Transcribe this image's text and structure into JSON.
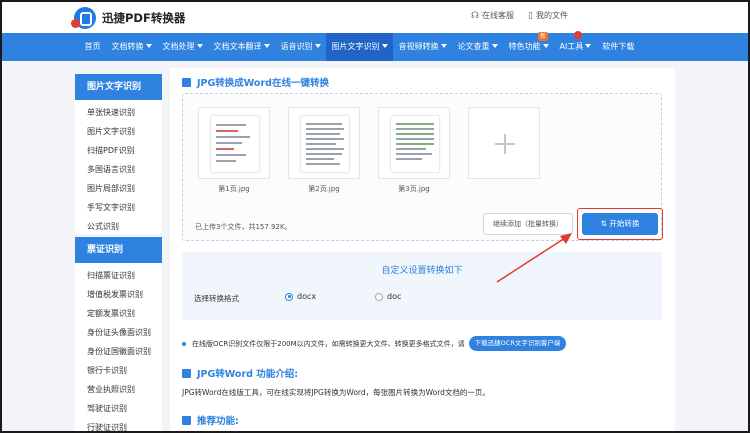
{
  "header": {
    "logo_text": "迅捷PDF转换器",
    "service_link": "在线客服",
    "files_link": "我的文件"
  },
  "nav": {
    "items": [
      {
        "label": "首页"
      },
      {
        "label": "文档转换"
      },
      {
        "label": "文档处理"
      },
      {
        "label": "文档文本翻译"
      },
      {
        "label": "语音识别"
      },
      {
        "label": "图片文字识别"
      },
      {
        "label": "音视频转换"
      },
      {
        "label": "论文查重"
      },
      {
        "label": "特色功能"
      },
      {
        "label": "AI工具"
      },
      {
        "label": "软件下载"
      }
    ],
    "new_badge": "新"
  },
  "sidebar": {
    "group1_title": "图片文字识别",
    "group1_items": [
      "单张快速识别",
      "图片文字识别",
      "扫描PDF识别",
      "多国语言识别",
      "图片局部识别",
      "手写文字识别",
      "公式识别"
    ],
    "group2_title": "票证识别",
    "group2_items": [
      "扫描票证识别",
      "增值税发票识别",
      "定额发票识别",
      "身份证头像面识别",
      "身份证国徽面识别",
      "银行卡识别",
      "营业执照识别",
      "驾驶证识别",
      "行驶证识别"
    ]
  },
  "main": {
    "title": "JPG转换成Word在线一键转换",
    "thumbnails": [
      {
        "label": "第1页.jpg"
      },
      {
        "label": "第2页.jpg"
      },
      {
        "label": "第3页.jpg"
      }
    ],
    "upload_info": "已上传3个文件，共157.92K。",
    "continue_button": "继续添加（批量转换）",
    "start_button": "开始转换",
    "settings_title": "自定义设置转换如下",
    "format_label": "选择转换格式",
    "format_options": [
      "docx",
      "doc"
    ],
    "selected_format": "docx",
    "notice": "在线版OCR识别文件仅限于200M以内文件，如需转换更大文件、转换更多格式文件，请",
    "client_button": "下载迅捷OCR文字识别客户端",
    "intro_title": "JPG转Word 功能介绍:",
    "intro_text": "JPG转Word在线版工具，可在线实现将JPG转换为Word，每张图片转换为Word文档的一页。",
    "recommend_title": "推荐功能:"
  },
  "colors": {
    "brand_blue": "#2f82e0",
    "nav_active": "#1f64c6",
    "highlight_red": "#e23a2e"
  }
}
